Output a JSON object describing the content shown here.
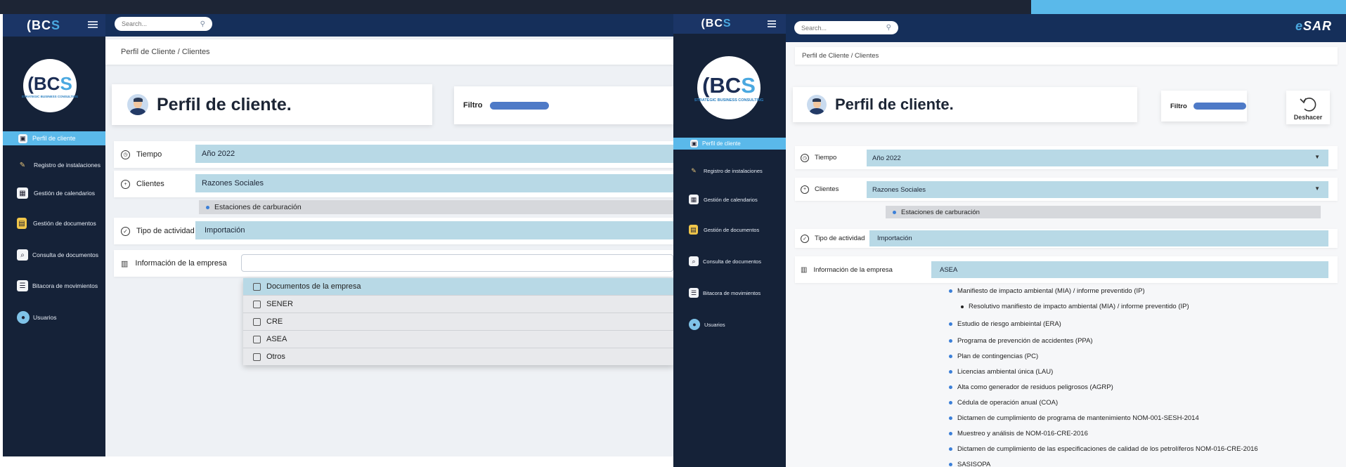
{
  "brand": {
    "logo_text_a": "BC",
    "logo_text_b": "S",
    "logo_subtitle": "STRATEGIC BUSINESS CONSULTING"
  },
  "search": {
    "placeholder": "Search..."
  },
  "partner_logo": {
    "text_a": "e",
    "text_b": "SAR"
  },
  "breadcrumb": "Perfil de Cliente / Clientes",
  "page_title": "Perfil de cliente.",
  "filter": {
    "label": "Filtro"
  },
  "undo": {
    "label": "Deshacer"
  },
  "sidebar": {
    "items": [
      {
        "label": "Perfil de cliente",
        "icon": "profile-icon",
        "active": true
      },
      {
        "label": "Registro de instalaciones",
        "icon": "installations-icon"
      },
      {
        "label": "Gestión de calendarios",
        "icon": "calendar-icon"
      },
      {
        "label": "Gestión de documentos",
        "icon": "documents-icon"
      },
      {
        "label": "Consulta de documentos",
        "icon": "document-search-icon"
      },
      {
        "label": "Bitacora de movimientos",
        "icon": "log-icon"
      },
      {
        "label": "Usuarios",
        "icon": "users-icon"
      }
    ]
  },
  "fields": {
    "time": {
      "label": "Tiempo",
      "value": "Año 2022"
    },
    "clients": {
      "label": "Clientes",
      "value": "Razones Sociales",
      "sub": "Estaciones de carburación"
    },
    "activity": {
      "label": "Tipo de actividad",
      "value": "Importación"
    },
    "company": {
      "label": "Información de la empresa",
      "value_left": "",
      "value_right": "ASEA"
    }
  },
  "company_dropdown": {
    "options": [
      "Documentos de la empresa",
      "SENER",
      "CRE",
      "ASEA",
      "Otros"
    ],
    "selected_index": 0
  },
  "asea_documents": [
    "Manifiesto de impacto ambiental (MIA) / informe preventido (IP)",
    "Resolutivo manifiesto de impacto ambiental (MIA) / informe preventido (IP)",
    "Estudio de riesgo ambieintal (ERA)",
    "Programa de prevención de accidentes (PPA)",
    "Plan de contingencias (PC)",
    "Licencias ambiental única (LAU)",
    "Alta como generador de residuos peligrosos (AGRP)",
    "Cédula de operación anual (COA)",
    "Dictamen de cumplimiento de programa de mantenimiento NOM-001-SESH-2014",
    "Muestreo y análisis de NOM-016-CRE-2016",
    "Dictamen de cumplimiento de las especificaciones de calidad de los petrolíferos NOM-016-CRE-2016",
    "SASISOPA"
  ],
  "colors": {
    "accent": "#5ab9ea",
    "sidebar": "#152238",
    "topbar": "#152f5a",
    "field": "#b8d9e6",
    "filter_bar": "#4e7ac7"
  }
}
